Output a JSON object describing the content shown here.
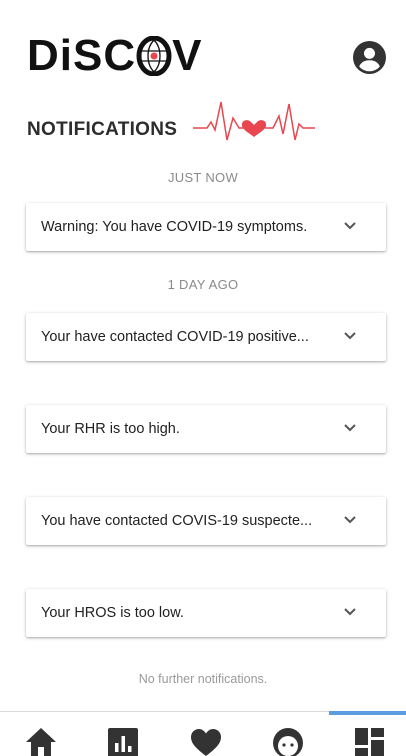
{
  "app": {
    "logo_text_left": "DiSC",
    "logo_text_right": "V"
  },
  "page": {
    "title": "NOTIFICATIONS"
  },
  "sections": [
    {
      "label": "JUST NOW",
      "notifications": [
        {
          "text": "Warning: You have COVID-19 symptoms."
        }
      ]
    },
    {
      "label": "1 DAY AGO",
      "notifications": [
        {
          "text": "Your have contacted COVID-19 positive..."
        },
        {
          "text": "Your RHR is too high."
        },
        {
          "text": "You have contacted COVIS-19 suspecte..."
        },
        {
          "text": "Your HROS is too low."
        }
      ]
    }
  ],
  "footer_note": "No further notifications.",
  "nav": {
    "items": [
      "home-icon",
      "bar-chart-icon",
      "heart-icon",
      "face-icon",
      "dashboard-icon"
    ],
    "active_index": 4
  },
  "colors": {
    "accent_red": "#e8474f",
    "nav_active": "#5b9ce0",
    "icon_dark": "#333333"
  }
}
